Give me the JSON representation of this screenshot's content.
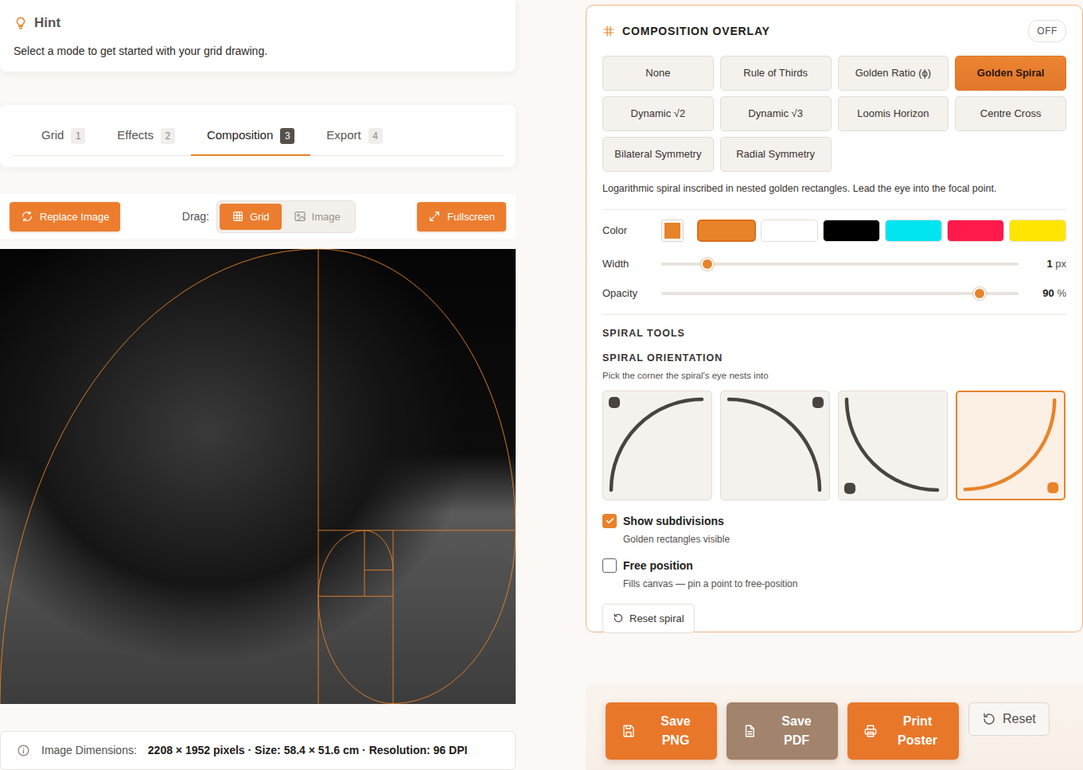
{
  "hint": {
    "title": "Hint",
    "text": "Select a mode to get started with your grid drawing."
  },
  "tabs": [
    {
      "label": "Grid",
      "count": "1",
      "selected": false
    },
    {
      "label": "Effects",
      "count": "2",
      "selected": false
    },
    {
      "label": "Composition",
      "count": "3",
      "selected": true
    },
    {
      "label": "Export",
      "count": "4",
      "selected": false
    }
  ],
  "toolbar": {
    "replace": "Replace Image",
    "drag_label": "Drag:",
    "drag_options": [
      {
        "label": "Grid",
        "selected": true
      },
      {
        "label": "Image",
        "selected": false
      }
    ],
    "fullscreen": "Fullscreen"
  },
  "info": {
    "label": "Image Dimensions:",
    "value": "2208 × 1952 pixels · Size: 58.4 × 51.6 cm · Resolution: 96 DPI"
  },
  "overlay": {
    "title": "COMPOSITION OVERLAY",
    "toggle": {
      "label": "OFF",
      "on": false
    },
    "modes": [
      {
        "label": "None",
        "selected": false
      },
      {
        "label": "Rule of Thirds",
        "selected": false
      },
      {
        "label": "Golden Ratio (ϕ)",
        "selected": false
      },
      {
        "label": "Golden Spiral",
        "selected": true
      },
      {
        "label": "Dynamic √2",
        "selected": false
      },
      {
        "label": "Dynamic √3",
        "selected": false
      },
      {
        "label": "Loomis Horizon",
        "selected": false
      },
      {
        "label": "Centre Cross",
        "selected": false
      },
      {
        "label": "Bilateral Symmetry",
        "selected": false
      },
      {
        "label": "Radial Symmetry",
        "selected": false
      }
    ],
    "description": "Logarithmic spiral inscribed in nested golden rectangles. Lead the eye into the focal point.",
    "color": {
      "label": "Color",
      "custom": "#e8832a",
      "swatches": [
        {
          "color": "#e8832a",
          "selected": true
        },
        {
          "color": "#ffffff",
          "selected": false
        },
        {
          "color": "#000000",
          "selected": false
        },
        {
          "color": "#00e5f0",
          "selected": false
        },
        {
          "color": "#ff1a4b",
          "selected": false
        },
        {
          "color": "#ffe600",
          "selected": false
        }
      ]
    },
    "width": {
      "label": "Width",
      "level": 0.13,
      "value": "1",
      "unit": "px"
    },
    "opacity": {
      "label": "Opacity",
      "level": 0.89,
      "value": "90",
      "unit": "%"
    },
    "spiral_tools": "SPIRAL TOOLS",
    "orientation": {
      "title": "SPIRAL ORIENTATION",
      "hint": "Pick the corner the spiral's eye nests into",
      "options": [
        {
          "kind": "top-left",
          "selected": false
        },
        {
          "kind": "top-right",
          "selected": false
        },
        {
          "kind": "bottom-left",
          "selected": false
        },
        {
          "kind": "bottom-right",
          "selected": true
        }
      ]
    },
    "checks": [
      {
        "label": "Show subdivisions",
        "sub": "Golden rectangles visible",
        "checked": true
      },
      {
        "label": "Free position",
        "sub": "Fills canvas — pin a point to free-position",
        "checked": false
      }
    ],
    "reset": "Reset spiral"
  },
  "actions": [
    {
      "label": "Save PNG",
      "kind": "filled",
      "color": "#e8772a"
    },
    {
      "label": "Save PDF",
      "kind": "filled",
      "color": "#a2836b"
    },
    {
      "label": "Print Poster",
      "kind": "filled",
      "color": "#e8772a"
    },
    {
      "label": "Reset",
      "kind": "outline",
      "color": "#f8f5f2"
    }
  ]
}
